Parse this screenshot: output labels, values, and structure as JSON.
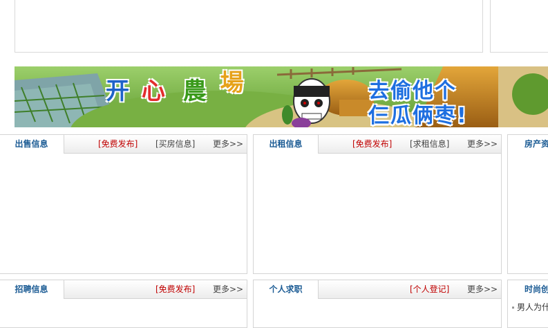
{
  "banner": {
    "logo_chars": [
      "开",
      "心",
      "農",
      "場"
    ],
    "slogan_line1": "去偷他个",
    "slogan_line2": "仨瓜俩枣!"
  },
  "panels_row1": [
    {
      "tab": "出售信息",
      "link_red": "[免费发布]",
      "link_gray": "[买房信息]",
      "more": "更多>>"
    },
    {
      "tab": "出租信息",
      "link_red": "[免费发布]",
      "link_gray": "[求租信息]",
      "more": "更多>>"
    },
    {
      "tab": "房产资"
    }
  ],
  "panels_row2": [
    {
      "tab": "招聘信息",
      "link_red": "[免费发布]",
      "more": "更多>>"
    },
    {
      "tab": "个人求职",
      "link_red": "[个人登记]",
      "more": "更多>>"
    },
    {
      "tab": "时尚创",
      "list_item": "男人为什"
    }
  ]
}
